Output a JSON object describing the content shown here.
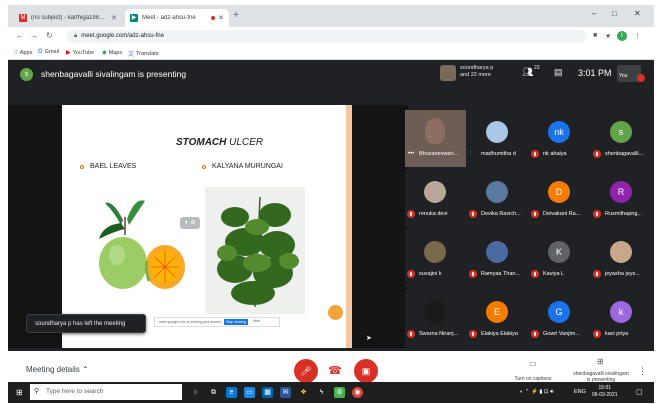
{
  "browser": {
    "tabs": [
      {
        "label": "(no subject) - karthiga1982019@g",
        "icon": "gmail-icon"
      },
      {
        "label": "Meet - adz-ahsu-fne",
        "icon": "meet-icon",
        "active": true
      }
    ],
    "new_tab": "+",
    "window_controls": [
      "–",
      "□",
      "✕"
    ],
    "url": "meet.google.com/adz-ahsu-fne",
    "bookmarks": [
      {
        "label": "Apps",
        "icon": "apps-icon"
      },
      {
        "label": "Gmail",
        "icon": "google-icon"
      },
      {
        "label": "YouTube",
        "icon": "youtube-icon"
      },
      {
        "label": "Maps",
        "icon": "maps-icon"
      },
      {
        "label": "Translate",
        "icon": "translate-icon"
      }
    ],
    "profile_initial": "t"
  },
  "meet": {
    "presenter": {
      "avatar_initial": "s",
      "text": "shenbagavalli sivalingam is presenting"
    },
    "others": {
      "line1": "soundharya p",
      "line2": "and 22 more"
    },
    "participant_count": "23",
    "time": "3:01 PM",
    "self_label": "You",
    "slide": {
      "title_bold": "STOMACH",
      "title_rest": " ULCER",
      "bullet_left": "BAEL LEAVES",
      "bullet_right": "KALYANA MURUNGAI",
      "share_banner": "meet.google.com is sharing your screen.",
      "stop_sharing": "Stop sharing",
      "hide": "Hide"
    },
    "toast": "soundharya p has left the meeting",
    "participants": [
      {
        "name": "Bhuvaneswari...",
        "type": "video"
      },
      {
        "name": "madhumitha d",
        "type": "avatar",
        "color": "#a8c7e6",
        "initial": "",
        "speaking": true
      },
      {
        "name": "nk ahalya",
        "type": "avatar",
        "color": "#1a73e8",
        "initial": "nk"
      },
      {
        "name": "shenbagavalli...",
        "type": "avatar",
        "color": "#63a44a",
        "initial": "s"
      },
      {
        "name": "renuka devi",
        "type": "avatar",
        "color": "#b8a89a",
        "initial": ""
      },
      {
        "name": "Devika Ravich...",
        "type": "avatar",
        "color": "#5a7aa0",
        "initial": ""
      },
      {
        "name": "Deivakani Ra...",
        "type": "avatar",
        "color": "#f57c00",
        "initial": "D"
      },
      {
        "name": "Rusmithapng...",
        "type": "avatar",
        "color": "#8e24aa",
        "initial": "R"
      },
      {
        "name": "suvajini k",
        "type": "avatar",
        "color": "#7a6a4a",
        "initial": ""
      },
      {
        "name": "Ramyaa Than...",
        "type": "avatar",
        "color": "#4a6aa0",
        "initial": ""
      },
      {
        "name": "Kaviya L",
        "type": "avatar",
        "color": "#5f6368",
        "initial": "K"
      },
      {
        "name": "jeyasha jeys...",
        "type": "avatar",
        "color": "#c9a88a",
        "initial": ""
      },
      {
        "name": "Swarna Niranj...",
        "type": "avatar",
        "color": "#1a1a1a",
        "initial": ""
      },
      {
        "name": "Elakiya Elakiya",
        "type": "avatar",
        "color": "#f57c00",
        "initial": "E"
      },
      {
        "name": "Gowri Vanjim...",
        "type": "avatar",
        "color": "#1a73e8",
        "initial": "G"
      },
      {
        "name": "kavi priya",
        "type": "avatar",
        "color": "#9c6ade",
        "initial": "k"
      }
    ],
    "controls": {
      "meeting_details": "Meeting details",
      "captions": "Turn on captions",
      "presenting_line1": "shenbagavalli sivalingam",
      "presenting_line2": "is presenting"
    }
  },
  "taskbar": {
    "search_placeholder": "Type here to search",
    "time": "15:01",
    "date": "06-03-2021",
    "lang": "ENG"
  }
}
